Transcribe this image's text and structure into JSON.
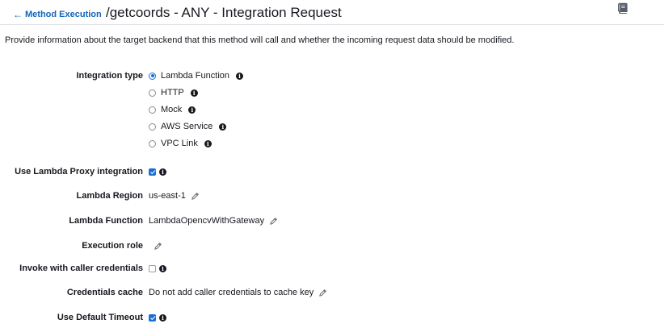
{
  "header": {
    "back_link": "Method Execution",
    "back_arrow": "🡐",
    "title": "/getcoords - ANY - Integration Request",
    "book_icon": "book-icon"
  },
  "intro": "Provide information about the target backend that this method will call and whether the incoming request data should be modified.",
  "form": {
    "integration_type": {
      "label": "Integration type",
      "options": [
        "Lambda Function",
        "HTTP",
        "Mock",
        "AWS Service",
        "VPC Link"
      ],
      "selected": "Lambda Function"
    },
    "lambda_proxy": {
      "label": "Use Lambda Proxy integration",
      "checked": true
    },
    "lambda_region": {
      "label": "Lambda Region",
      "value": "us-east-1"
    },
    "lambda_function": {
      "label": "Lambda Function",
      "value": "LambdaOpencvWithGateway"
    },
    "execution_role": {
      "label": "Execution role",
      "value": ""
    },
    "invoke_caller": {
      "label": "Invoke with caller credentials",
      "checked": false
    },
    "credentials_cache": {
      "label": "Credentials cache",
      "value": "Do not add caller credentials to cache key"
    },
    "default_timeout": {
      "label": "Use Default Timeout",
      "checked": true
    }
  },
  "colors": {
    "accent": "#1a6fd6",
    "link": "#1166bb",
    "text": "#16191f"
  }
}
